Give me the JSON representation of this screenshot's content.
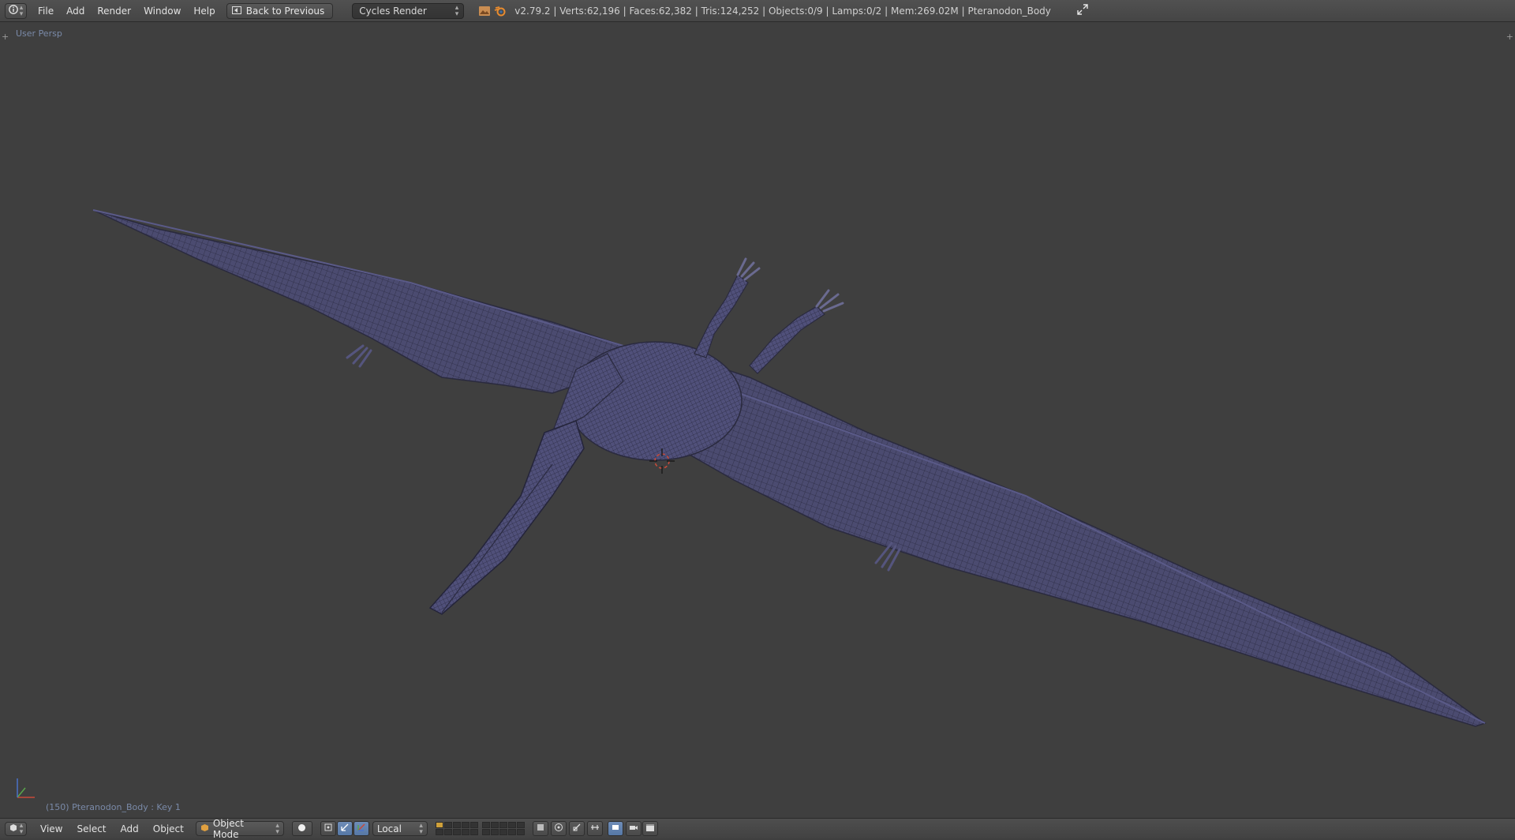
{
  "header": {
    "editor_icon": "info-icon",
    "menus": [
      "File",
      "Add",
      "Render",
      "Window",
      "Help"
    ],
    "back_button": "Back to Previous",
    "render_engine": "Cycles Render",
    "stats": "v2.79.2 | Verts:62,196 | Faces:62,382 | Tris:124,252 | Objects:0/9 | Lamps:0/2 | Mem:269.02M | Pteranodon_Body"
  },
  "viewport": {
    "view_label": "User Persp",
    "object_info": "(150) Pteranodon_Body : Key 1",
    "mesh_color": "#4a4a6e",
    "wire_color": "#2a2a40",
    "background_color": "#3f3f3f"
  },
  "footer": {
    "menus": [
      "View",
      "Select",
      "Add",
      "Object"
    ],
    "mode": "Object Mode",
    "pivot": "Local"
  },
  "colors": {
    "accent": "#5678a6",
    "header_bg": "#4b4b4b",
    "layer_selected": "#cfa03a"
  }
}
